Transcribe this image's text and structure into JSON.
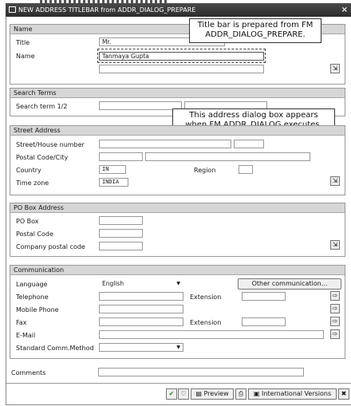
{
  "window": {
    "title": "NEW ADDRESS TITLEBAR from ADDR_DIALOG_PREPARE",
    "close": "×"
  },
  "callouts": {
    "titlebar_line1": "Title bar is prepared from FM",
    "titlebar_line2": "ADDR_DIALOG_PREPARE.",
    "dialog_line1": "This address dialog box appears",
    "dialog_line2": "when FM ADDR_DIALOG executes."
  },
  "name": {
    "header": "Name",
    "title_label": "Title",
    "title_value": "Mr.",
    "name_label": "Name",
    "name_value": "Tanmaya Gupta"
  },
  "search": {
    "header": "Search Terms",
    "label": "Search term 1/2"
  },
  "street": {
    "header": "Street Address",
    "house_label": "Street/House number",
    "postal_label": "Postal Code/City",
    "country_label": "Country",
    "country_value": "IN",
    "region_label": "Region",
    "timezone_label": "Time zone",
    "timezone_value": "INDIA"
  },
  "pobox": {
    "header": "PO Box Address",
    "pobox_label": "PO Box",
    "postal_label": "Postal Code",
    "company_label": "Company postal code"
  },
  "comm": {
    "header": "Communication",
    "language_label": "Language",
    "language_value": "English",
    "other_button": "Other communication...",
    "telephone_label": "Telephone",
    "extension_label": "Extension",
    "mobile_label": "Mobile Phone",
    "fax_label": "Fax",
    "fax_extension_label": "Extension",
    "email_label": "E-Mail",
    "std_method_label": "Standard Comm.Method"
  },
  "comments_label": "Comments",
  "toolbar": {
    "confirm": "✔",
    "check": "♡",
    "preview": "Preview",
    "international": "International Versions",
    "cancel": "✖"
  }
}
